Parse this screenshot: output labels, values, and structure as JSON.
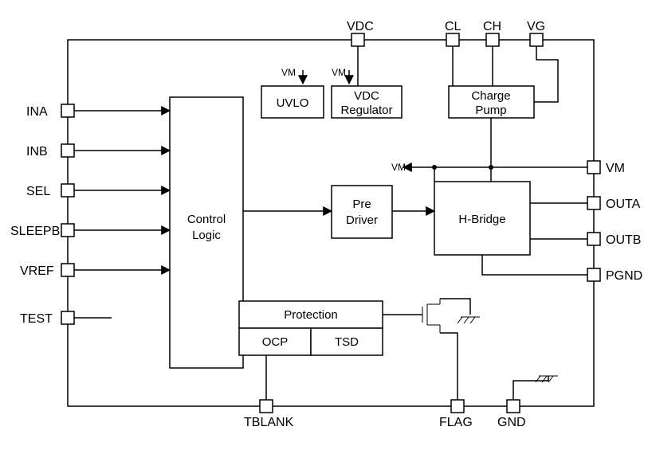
{
  "pins": {
    "left": {
      "ina": "INA",
      "inb": "INB",
      "sel": "SEL",
      "sleepb": "SLEEPB",
      "vref": "VREF",
      "test": "TEST"
    },
    "top": {
      "vdc": "VDC",
      "cl": "CL",
      "ch": "CH",
      "vg": "VG"
    },
    "right": {
      "vm": "VM",
      "outa": "OUTA",
      "outb": "OUTB",
      "pgnd": "PGND"
    },
    "bottom": {
      "tblank": "TBLANK",
      "flag": "FLAG",
      "gnd": "GND"
    }
  },
  "blocks": {
    "control_logic": {
      "l1": "Control",
      "l2": "Logic"
    },
    "uvlo": "UVLO",
    "vdc_reg": {
      "l1": "VDC",
      "l2": "Regulator"
    },
    "charge_pump": {
      "l1": "Charge",
      "l2": "Pump"
    },
    "pre_driver": {
      "l1": "Pre",
      "l2": "Driver"
    },
    "h_bridge": "H-Bridge",
    "protection": "Protection",
    "ocp": "OCP",
    "tsd": "TSD"
  },
  "annotations": {
    "vm_to_uvlo": "VM",
    "vm_to_vdc": "VM",
    "vm_to_hb": "VM"
  }
}
